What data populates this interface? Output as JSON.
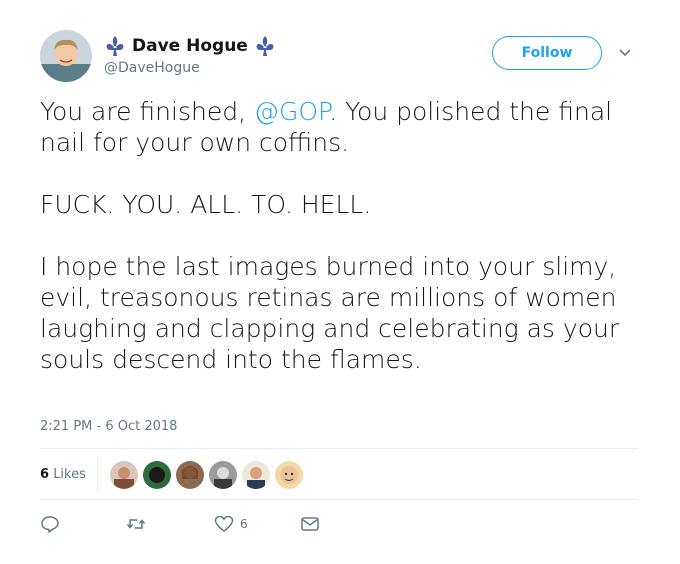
{
  "user": {
    "display_name": "Dave Hogue",
    "handle": "@DaveHogue"
  },
  "follow_button_label": "Follow",
  "tweet": {
    "line1_pre": "You are finished, ",
    "mention": "@GOP",
    "line1_post": ". You polished the final nail for your own coffins.",
    "para2": "FUCK. YOU. ALL. TO. HELL.",
    "para3": "I hope the last images burned into your slimy, evil, treasonous retinas are millions of women laughing and clapping and celebrating as your souls descend into the flames."
  },
  "timestamp": "2:21 PM - 6 Oct 2018",
  "stats": {
    "likes_count": "6",
    "likes_label": "Likes"
  },
  "actions": {
    "like_count": "6"
  },
  "colors": {
    "accent": "#1da1f2",
    "text": "#14171a",
    "muted": "#657786",
    "divider": "#e6ecf0"
  }
}
